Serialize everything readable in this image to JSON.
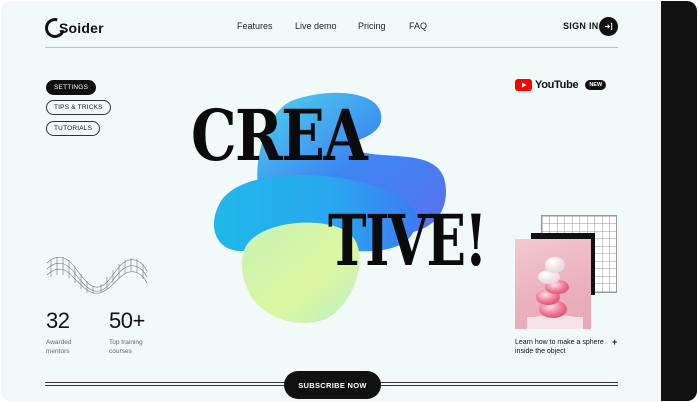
{
  "brand": {
    "name": "Soider"
  },
  "nav": {
    "items": [
      "Features",
      "Live demo",
      "Pricing",
      "FAQ"
    ]
  },
  "auth": {
    "signin_label": "SIGN IN"
  },
  "pills": [
    "SETTINGS",
    "TIPS & TRICKS",
    "TUTORIALS"
  ],
  "youtube": {
    "word": "YouTube",
    "badge": "NEW"
  },
  "hero": {
    "line1": "CREA",
    "line2": "TIVE!"
  },
  "stats": [
    {
      "value": "32",
      "label": "Awarded mentors"
    },
    {
      "value": "50+",
      "label": "Top training courses"
    }
  ],
  "card": {
    "text": "Learn how to make a sphere inside the object",
    "plus": "+"
  },
  "cta": {
    "subscribe_label": "SUBSCRIBE NOW"
  },
  "colors": {
    "page_bg": "#f1faf9",
    "ink": "#111111",
    "youtube_red": "#ff0000",
    "blob_blue": "#3d7bf0",
    "blob_cyan": "#22c3e6",
    "blob_lime": "#d8f59a"
  },
  "icons": {
    "signin": "sign-in-arrow-icon",
    "youtube": "youtube-play-icon"
  }
}
